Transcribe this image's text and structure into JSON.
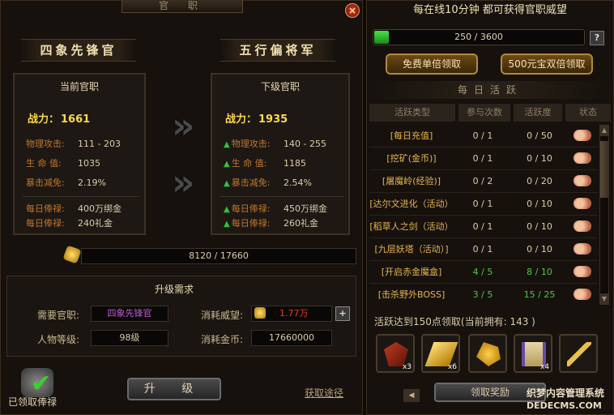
{
  "left_panel": {
    "title": "官 职",
    "close_glyph": "×",
    "current_rank_name": "四象先锋官",
    "next_rank_name": "五行偏将军",
    "current": {
      "header": "当前官职",
      "power_label": "战力：",
      "power": "1661",
      "stats": [
        {
          "label": "物理攻击:",
          "value": "111 - 203"
        },
        {
          "label": "生 命 值:",
          "value": "1035"
        },
        {
          "label": "暴击减免:",
          "value": "2.19%"
        }
      ],
      "salary": [
        {
          "label": "每日俸禄:",
          "value": "400万绑金"
        },
        {
          "label": "每日俸禄:",
          "value": "240礼金"
        }
      ]
    },
    "next": {
      "header": "下级官职",
      "power_label": "战力：",
      "power": "1935",
      "stats": [
        {
          "label": "物理攻击:",
          "value": "140 - 255"
        },
        {
          "label": "生 命 值:",
          "value": "1185"
        },
        {
          "label": "暴击减免:",
          "value": "2.54%"
        }
      ],
      "salary": [
        {
          "label": "每日俸禄:",
          "value": "450万绑金"
        },
        {
          "label": "每日俸禄:",
          "value": "260礼金"
        }
      ]
    },
    "gold_progress": "8120 / 17660",
    "requirements": {
      "title": "升级需求",
      "rank_label": "需要官职:",
      "rank_value": "四象先锋官",
      "level_label": "人物等级:",
      "level_value": "98级",
      "prestige_label": "消耗威望:",
      "prestige_value": "1.77万",
      "gold_label": "消耗金币:",
      "gold_value": "17660000",
      "plus_glyph": "+"
    },
    "upgrade_button": "升 级",
    "claimed_label": "已领取俸禄",
    "path_link": "获取途径"
  },
  "right_panel": {
    "title": "每在线10分钟 都可获得官职威望",
    "progress_text": "250 / 3600",
    "progress_fraction": 0.069,
    "help_glyph": "?",
    "free_claim_button": "免费单倍领取",
    "paid_claim_button": "500元宝双倍领取",
    "daily_title": "每日活跃",
    "columns": [
      "活跃类型",
      "参与次数",
      "活跃度",
      "状态"
    ],
    "activities": [
      {
        "name": "[每日充值]",
        "count": "0 / 1",
        "active": "0 / 50",
        "done": false
      },
      {
        "name": "[挖矿(金币)]",
        "count": "0 / 1",
        "active": "0 / 10",
        "done": false
      },
      {
        "name": "[屠魔岭(经验)]",
        "count": "0 / 2",
        "active": "0 / 20",
        "done": false
      },
      {
        "name": "[达尔文进化（活动）",
        "count": "0 / 1",
        "active": "0 / 10",
        "done": false
      },
      {
        "name": "[稻草人之剑（活动）",
        "count": "0 / 1",
        "active": "0 / 10",
        "done": false
      },
      {
        "name": "[九层妖塔（活动）]",
        "count": "0 / 1",
        "active": "0 / 10",
        "done": false
      },
      {
        "name": "[开启赤金魔盒]",
        "count": "4 / 5",
        "active": "8 / 10",
        "done": true
      },
      {
        "name": "[击杀野外BOSS]",
        "count": "3 / 5",
        "active": "15 / 25",
        "done": true
      }
    ],
    "reward_line": "活跃达到150点领取(当前拥有:   143   )",
    "rewards": [
      {
        "icon": "wing-emblem-icon",
        "count": "x3"
      },
      {
        "icon": "gold-bar-icon",
        "count": "x6"
      },
      {
        "icon": "gold-ore-icon",
        "count": ""
      },
      {
        "icon": "scroll-icon",
        "count": "x4"
      },
      {
        "icon": "key-icon",
        "count": ""
      }
    ],
    "claim_button": "领取奖励",
    "prev_glyph": "◀",
    "watermark_1": "织梦内容管理系统",
    "watermark_2": "DEDECMS.COM"
  }
}
